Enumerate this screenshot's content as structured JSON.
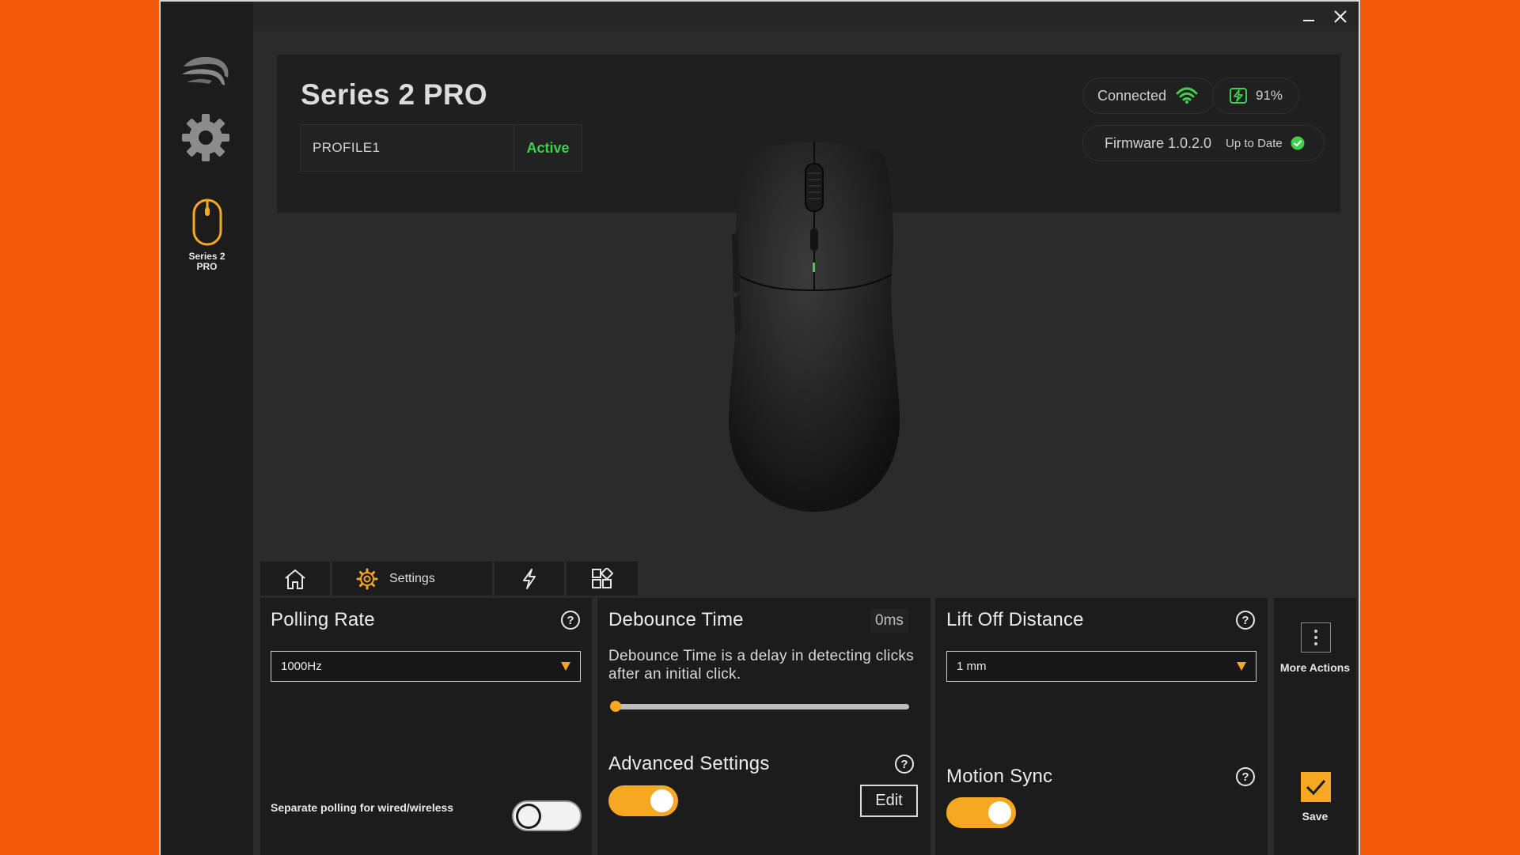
{
  "window": {
    "minimize_icon": "minimize-icon",
    "close_icon": "close-icon"
  },
  "sidebar": {
    "logo_icon": "brand-logo-icon",
    "settings_icon": "gear-icon",
    "device_label": "Series 2 PRO",
    "accent": "#f7a823"
  },
  "header": {
    "device_title": "Series 2 PRO",
    "profile_name": "PROFILE1",
    "profile_status": "Active",
    "connection_label": "Connected",
    "battery": "91%",
    "firmware_label": "Firmware 1.0.2.0",
    "firmware_status": "Up to Date"
  },
  "tabs": [
    {
      "icon": "home-icon",
      "label": ""
    },
    {
      "icon": "gear-icon",
      "label": "Settings"
    },
    {
      "icon": "lightning-icon",
      "label": ""
    },
    {
      "icon": "layout-icon",
      "label": ""
    }
  ],
  "polling": {
    "title": "Polling Rate",
    "value": "1000Hz",
    "separate_label": "Separate polling for wired/wireless",
    "separate_enabled": false
  },
  "debounce": {
    "title": "Debounce Time",
    "value_badge": "0ms",
    "description": "Debounce Time is a delay in detecting clicks after an initial click.",
    "slider_value": 0,
    "advanced_title": "Advanced Settings",
    "advanced_enabled": true,
    "edit_label": "Edit"
  },
  "liftoff": {
    "title": "Lift Off Distance",
    "value": "1 mm",
    "motion_sync_title": "Motion Sync",
    "motion_sync_enabled": true
  },
  "actions": {
    "more_label": "More Actions",
    "save_label": "Save"
  },
  "colors": {
    "accent_orange": "#f7a823",
    "status_green": "#3fd04b",
    "background_orange": "#f15a0a"
  }
}
